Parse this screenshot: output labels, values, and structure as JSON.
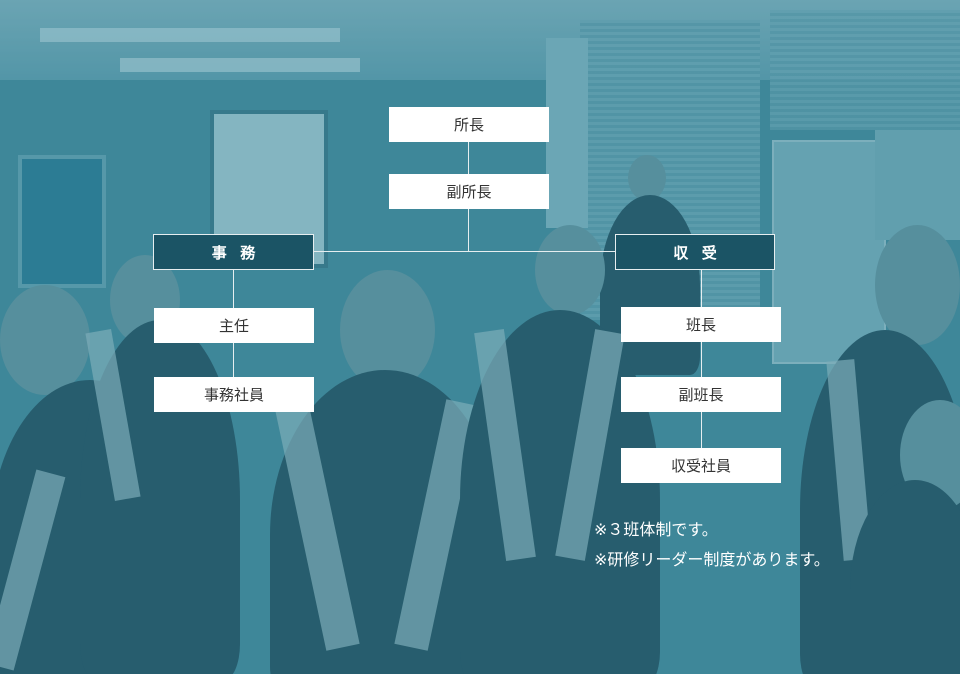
{
  "org_chart": {
    "top": {
      "director": "所長",
      "deputy_director": "副所長"
    },
    "office_dept": {
      "label": "事務",
      "members": [
        "主任",
        "事務社員"
      ]
    },
    "toll_dept": {
      "label": "収受",
      "members": [
        "班長",
        "副班長",
        "収受社員"
      ]
    }
  },
  "notes": [
    "※３班体制です。",
    "※研修リーダー制度があります。"
  ]
}
